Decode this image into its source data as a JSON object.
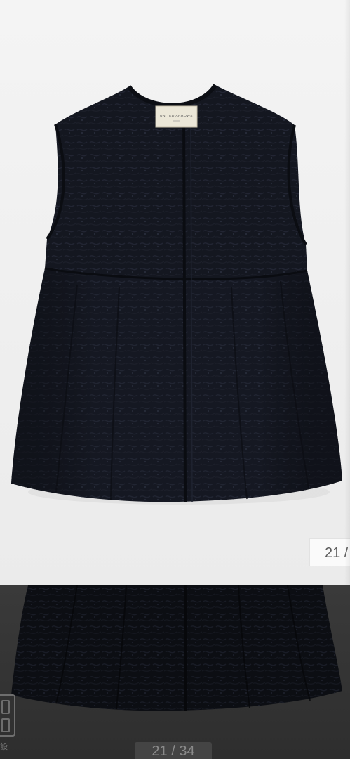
{
  "gallery": {
    "product_label_text": "UNITED ARROWS",
    "counter_top": "21 /",
    "counter_bottom": "21 / 34",
    "side_label": "設"
  },
  "colors": {
    "background_top": "#efefef",
    "garment": "#141720",
    "bottom_background": "#2d2d2d"
  }
}
